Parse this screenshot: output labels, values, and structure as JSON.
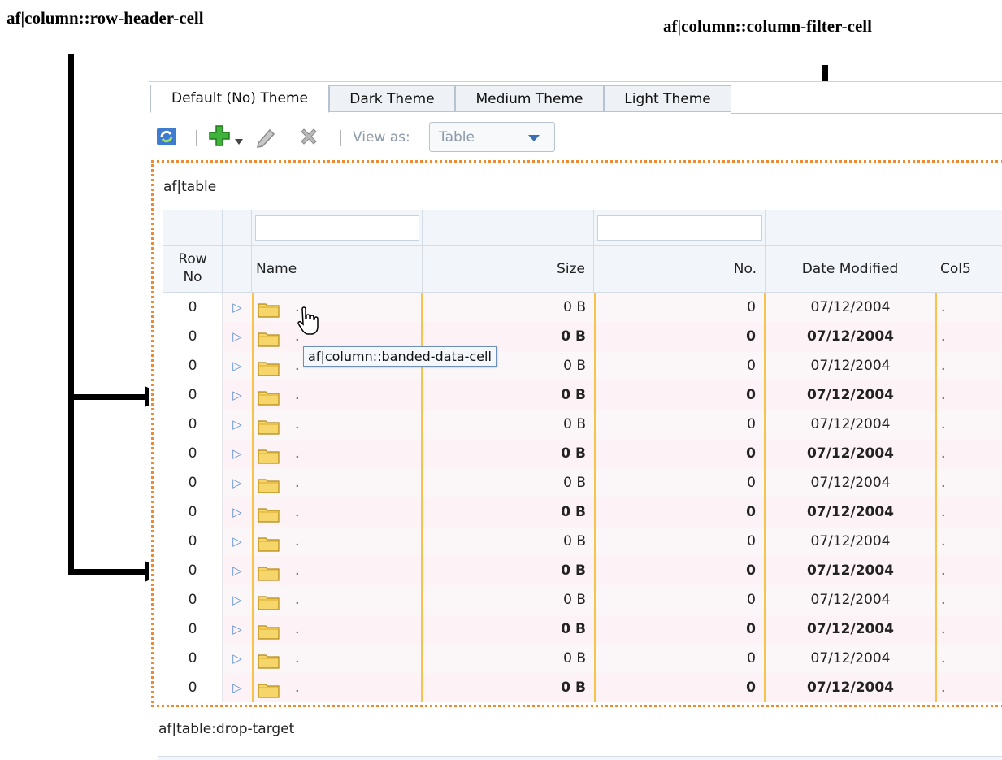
{
  "annotations": {
    "row_header_cell": "af|column::row-header-cell",
    "column_filter_cell": "af|column::column-filter-cell"
  },
  "tabs": [
    {
      "label": "Default (No) Theme",
      "active": true
    },
    {
      "label": "Dark Theme",
      "active": false
    },
    {
      "label": "Medium Theme",
      "active": false
    },
    {
      "label": "Light Theme",
      "active": false
    }
  ],
  "toolbar": {
    "icons": [
      "refresh-icon",
      "add-icon",
      "dropdown-caret-icon",
      "edit-icon",
      "delete-icon"
    ],
    "view_as_label": "View as:",
    "view_as_value": "Table"
  },
  "table": {
    "label": "af|table",
    "columns": [
      "Row No",
      "",
      "Name",
      "Size",
      "No.",
      "Date Modified",
      "Col5"
    ],
    "rows": [
      {
        "row_no": "0",
        "name": ".",
        "size": "0 B",
        "no": "0",
        "date": "07/12/2004",
        "col5": "."
      },
      {
        "row_no": "0",
        "name": ".",
        "size": "0 B",
        "no": "0",
        "date": "07/12/2004",
        "col5": "."
      },
      {
        "row_no": "0",
        "name": ".",
        "size": "0 B",
        "no": "0",
        "date": "07/12/2004",
        "col5": "."
      },
      {
        "row_no": "0",
        "name": ".",
        "size": "0 B",
        "no": "0",
        "date": "07/12/2004",
        "col5": "."
      },
      {
        "row_no": "0",
        "name": ".",
        "size": "0 B",
        "no": "0",
        "date": "07/12/2004",
        "col5": "."
      },
      {
        "row_no": "0",
        "name": ".",
        "size": "0 B",
        "no": "0",
        "date": "07/12/2004",
        "col5": "."
      },
      {
        "row_no": "0",
        "name": ".",
        "size": "0 B",
        "no": "0",
        "date": "07/12/2004",
        "col5": "."
      },
      {
        "row_no": "0",
        "name": ".",
        "size": "0 B",
        "no": "0",
        "date": "07/12/2004",
        "col5": "."
      },
      {
        "row_no": "0",
        "name": ".",
        "size": "0 B",
        "no": "0",
        "date": "07/12/2004",
        "col5": "."
      },
      {
        "row_no": "0",
        "name": ".",
        "size": "0 B",
        "no": "0",
        "date": "07/12/2004",
        "col5": "."
      },
      {
        "row_no": "0",
        "name": ".",
        "size": "0 B",
        "no": "0",
        "date": "07/12/2004",
        "col5": "."
      },
      {
        "row_no": "0",
        "name": ".",
        "size": "0 B",
        "no": "0",
        "date": "07/12/2004",
        "col5": "."
      },
      {
        "row_no": "0",
        "name": ".",
        "size": "0 B",
        "no": "0",
        "date": "07/12/2004",
        "col5": "."
      },
      {
        "row_no": "0",
        "name": ".",
        "size": "0 B",
        "no": "0",
        "date": "07/12/2004",
        "col5": "."
      }
    ],
    "tooltip": "af|column::banded-data-cell",
    "drop_target_label": "af|table:drop-target"
  },
  "colors": {
    "band_border": "#f6c44c",
    "table_outline": "#f08a2c",
    "header_bg": "#f2f5f9"
  }
}
